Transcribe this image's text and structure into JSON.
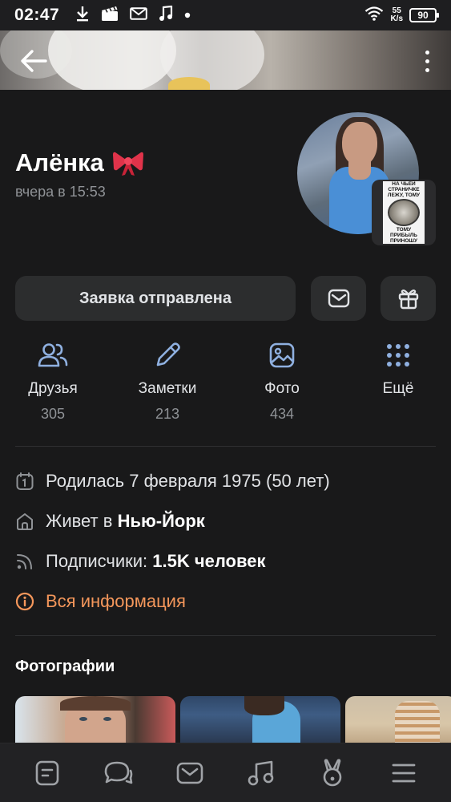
{
  "status_bar": {
    "time": "02:47",
    "net_speed_value": "55",
    "net_speed_unit": "K/s",
    "battery": "90",
    "icons": [
      "download-icon",
      "clapperboard-icon",
      "mail-icon",
      "music-note-icon",
      "dot-icon",
      "wifi-icon",
      "battery-icon"
    ]
  },
  "header": {
    "back_icon": "arrow-left-icon",
    "menu_icon": "more-vertical-icon"
  },
  "profile": {
    "name": "Алёнка",
    "name_emoji": "bow-icon",
    "last_seen": "вчера в 15:53",
    "sticker_top": "НА ЧЬЕЙ СТРАНИЧКЕ ЛЕЖУ, ТОМУ",
    "sticker_bottom": "ТОМУ ПРИБЫЛЬ ПРИНОШУ"
  },
  "actions": {
    "request_label": "Заявка отправлена",
    "message_icon": "mail-icon",
    "gift_icon": "gift-icon"
  },
  "counters": [
    {
      "icon": "users-icon",
      "label": "Друзья",
      "value": "305"
    },
    {
      "icon": "pencil-icon",
      "label": "Заметки",
      "value": "213"
    },
    {
      "icon": "image-icon",
      "label": "Фото",
      "value": "434"
    },
    {
      "icon": "grid-dots-icon",
      "label": "Ещё",
      "value": ""
    }
  ],
  "info": {
    "birthday": "Родилась 7 февраля 1975 (50 лет)",
    "city_prefix": "Живет в",
    "city": "Нью-Йорк",
    "followers_prefix": "Подписчики:",
    "followers": "1.5K человек",
    "all_info": "Вся информация"
  },
  "photos_section": {
    "title": "Фотографии"
  },
  "bottom_nav": [
    {
      "icon": "newsfeed-icon"
    },
    {
      "icon": "chat-bubbles-icon"
    },
    {
      "icon": "mail-icon"
    },
    {
      "icon": "music-note-icon"
    },
    {
      "icon": "bunny-icon"
    },
    {
      "icon": "hamburger-menu-icon"
    }
  ],
  "colors": {
    "background": "#19191a",
    "surface": "#2c2d2e",
    "text_primary": "#e1e3e6",
    "text_secondary": "#8f9296",
    "accent": "#f5975b"
  }
}
